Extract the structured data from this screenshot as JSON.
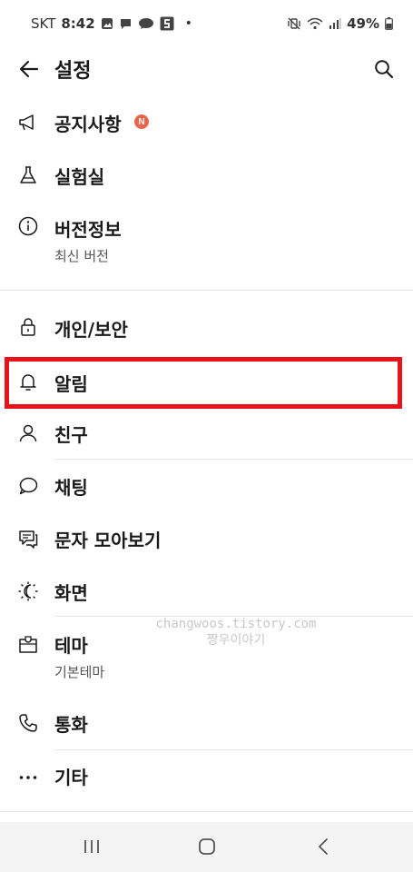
{
  "status_bar": {
    "carrier": "SKT",
    "time": "8:42",
    "battery": "49%",
    "dot": "•"
  },
  "header": {
    "title": "설정"
  },
  "menu": {
    "notice": {
      "label": "공지사항",
      "badge": "N"
    },
    "lab": {
      "label": "실험실"
    },
    "version": {
      "label": "버전정보",
      "sub": "최신 버전"
    },
    "privacy": {
      "label": "개인/보안"
    },
    "alarm": {
      "label": "알림"
    },
    "friends": {
      "label": "친구"
    },
    "chat": {
      "label": "채팅"
    },
    "sms": {
      "label": "문자 모아보기"
    },
    "screen": {
      "label": "화면"
    },
    "theme": {
      "label": "테마",
      "sub": "기본테마"
    },
    "call": {
      "label": "통화"
    },
    "etc": {
      "label": "기타"
    }
  },
  "watermark": {
    "line1": "changwoos.tistory.com",
    "line2": "짱우이야기"
  },
  "colors": {
    "highlight": "#e8121b",
    "badge": "#e8674a"
  }
}
